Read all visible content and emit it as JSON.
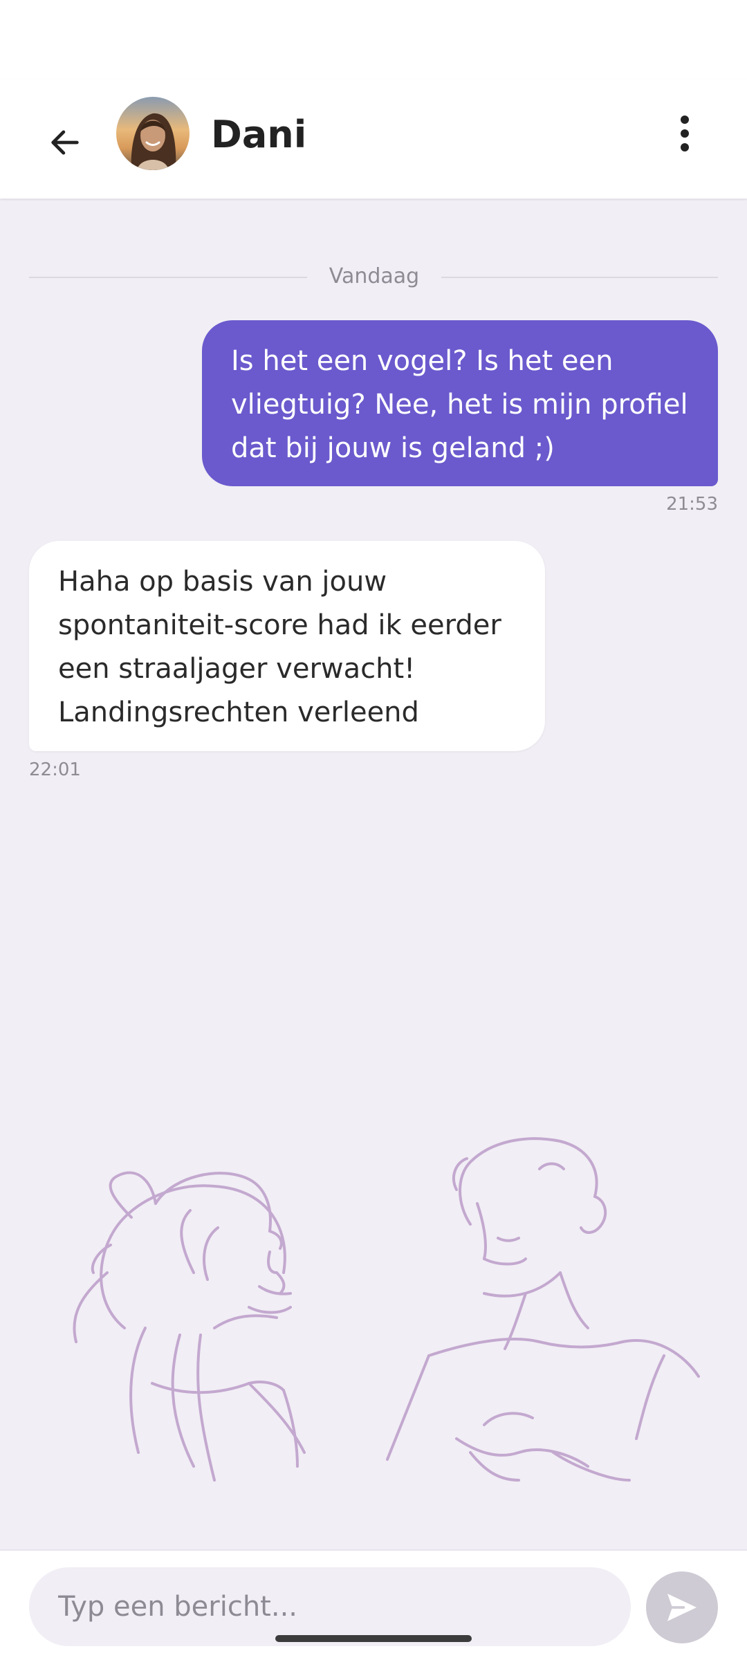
{
  "header": {
    "contact_name": "Dani",
    "back_icon": "arrow-left-icon",
    "menu_icon": "more-vertical-icon",
    "avatar_alt": "avatar"
  },
  "conversation": {
    "date_label": "Vandaag",
    "messages": [
      {
        "direction": "outgoing",
        "text": "Is het een vogel? Is het een vliegtuig? Nee, het is mijn profiel dat bij jouw is geland ;)",
        "time": "21:53"
      },
      {
        "direction": "incoming",
        "text": "Haha op basis van jouw spontaniteit-score had ik eerder een straaljager verwacht! Landingsrechten verleend",
        "time": "22:01"
      }
    ]
  },
  "composer": {
    "placeholder": "Typ een bericht...",
    "value": "",
    "send_icon": "send-icon"
  },
  "colors": {
    "accent": "#6a5acd",
    "chat_background": "#f1eef5",
    "illustration_stroke": "#c3a8cf",
    "send_button_disabled": "#cfcbd4"
  }
}
